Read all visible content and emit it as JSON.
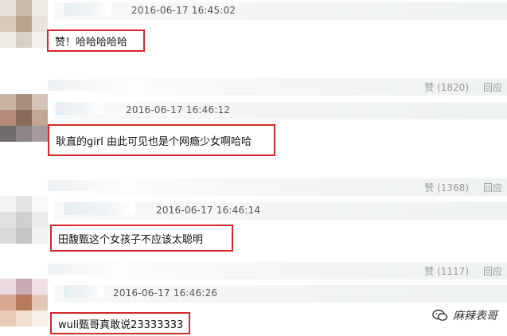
{
  "comments": [
    {
      "timestamp": "2016-06-17 16:45:02",
      "text": "赞！哈哈哈哈哈",
      "likes": "赞 (1820)",
      "reply": "回应"
    },
    {
      "timestamp": "2016-06-17 16:46:12",
      "text": "耿直的girl 由此可见也是个网瘾少女啊哈哈",
      "likes": "赞 (1368)",
      "reply": "回应"
    },
    {
      "timestamp": "2016-06-17 16:46:14",
      "text": "田馥甄这个女孩子不应该太聪明",
      "likes": "赞 (1117)",
      "reply": "回应"
    },
    {
      "timestamp": "2016-06-17 16:46:26",
      "text": "wuli甄哥真敢说23333333",
      "likes": "",
      "reply": ""
    }
  ],
  "watermark": {
    "text": "麻辣表哥",
    "icon": "wechat-icon"
  },
  "colors": {
    "highlight_border": "#d6282c",
    "muted_text": "#9a9a9a"
  }
}
